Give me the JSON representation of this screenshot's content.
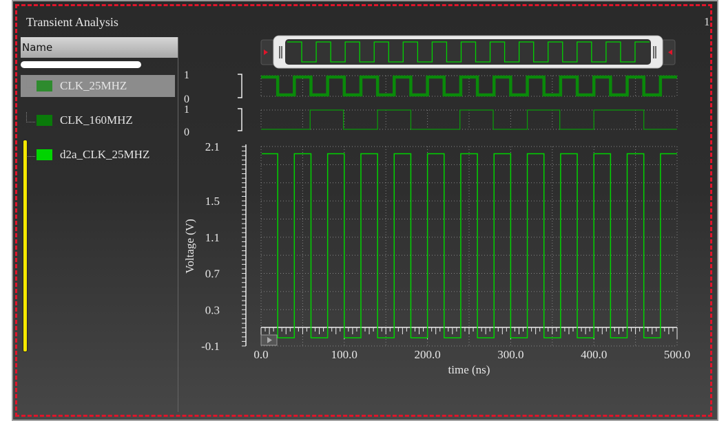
{
  "window": {
    "title": "Transient Analysis",
    "page_number": "1"
  },
  "signal_list": {
    "header": "Name",
    "signals": [
      {
        "name": "CLK_25MHZ",
        "color": "#2e8b2e",
        "selected": true
      },
      {
        "name": "CLK_160MHZ",
        "color": "#0a7a0a",
        "selected": false
      },
      {
        "name": "d2a_CLK_25MHZ",
        "color": "#00d400",
        "selected": false
      }
    ]
  },
  "chart_data": {
    "type": "line",
    "xlabel": "time (ns)",
    "ylabel": "Voltage (V)",
    "xlim": [
      0,
      500
    ],
    "ylim": [
      -0.1,
      2.1
    ],
    "xticks": [
      "0.0",
      "100.0",
      "200.0",
      "300.0",
      "400.0",
      "500.0"
    ],
    "xtick_values": [
      0,
      100,
      200,
      300,
      400,
      500
    ],
    "yticks": [
      "2.1",
      "1.5",
      "1.1",
      "0.7",
      "0.3",
      "-0.1"
    ],
    "ytick_values": [
      2.1,
      1.5,
      1.1,
      0.7,
      0.3,
      -0.1
    ],
    "grid": true,
    "digital": [
      {
        "name": "CLK_25MHZ",
        "labels": [
          "1",
          "0"
        ],
        "initial": 1,
        "transitions": [
          20,
          40,
          60,
          80,
          100,
          120,
          140,
          160,
          180,
          200,
          220,
          240,
          260,
          280,
          300,
          320,
          340,
          360,
          380,
          400,
          420,
          440,
          460,
          480
        ]
      },
      {
        "name": "CLK_160MHZ",
        "labels": [
          "1",
          "0"
        ],
        "initial": 0,
        "transitions": [
          59,
          99,
          140,
          180,
          239,
          279,
          320,
          359,
          400,
          460
        ]
      }
    ],
    "analog": {
      "name": "d2a_CLK_25MHZ",
      "high": 2.02,
      "low": -0.01,
      "initial": "high",
      "transitions": [
        20,
        40,
        60,
        80,
        100,
        120,
        140,
        160,
        180,
        200,
        220,
        240,
        260,
        280,
        300,
        320,
        340,
        360,
        380,
        400,
        420,
        440,
        460,
        480
      ]
    }
  },
  "colors": {
    "wave": "#00d400",
    "digital_thick": "#0a8a0a",
    "digital_thin": "#0a9a0a",
    "border": "#e0142a",
    "selection": "#f5e800"
  }
}
